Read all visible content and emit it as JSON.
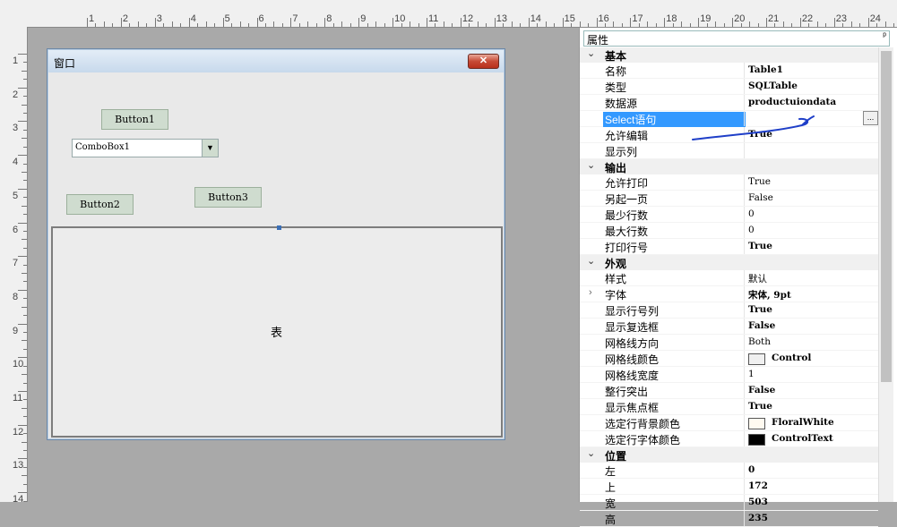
{
  "ruler": {
    "h_labels": [
      "1",
      "2",
      "3",
      "4",
      "5",
      "6",
      "7",
      "8",
      "9",
      "10",
      "11",
      "12",
      "13",
      "14",
      "15",
      "16",
      "17",
      "18",
      "19",
      "20",
      "21",
      "22",
      "23",
      "24"
    ],
    "v_labels": [
      "1",
      "2",
      "3",
      "4",
      "5",
      "6",
      "7",
      "8",
      "9",
      "10",
      "11",
      "12",
      "13",
      "14"
    ]
  },
  "form": {
    "title": "窗口",
    "close_glyph": "✕",
    "button1": "Button1",
    "button2": "Button2",
    "button3": "Button3",
    "combobox": "ComboBox1",
    "combo_arrow": "▼",
    "table_label": "表"
  },
  "property_grid": {
    "title": "属性",
    "pin": "ᵖ",
    "categories": {
      "basic": "基本",
      "output": "输出",
      "appearance": "外观",
      "position": "位置"
    },
    "props": {
      "name": {
        "label": "名称",
        "value": "Table1"
      },
      "type": {
        "label": "类型",
        "value": "SQLTable"
      },
      "datasource": {
        "label": "数据源",
        "value": "productuiondata"
      },
      "select": {
        "label": "Select语句",
        "value": ""
      },
      "allow_edit": {
        "label": "允许编辑",
        "value": "True"
      },
      "show_columns": {
        "label": "显示列",
        "value": ""
      },
      "allow_print": {
        "label": "允许打印",
        "value": "True"
      },
      "new_page": {
        "label": "另起一页",
        "value": "False"
      },
      "min_rows": {
        "label": "最少行数",
        "value": "0"
      },
      "max_rows": {
        "label": "最大行数",
        "value": "0"
      },
      "print_rownum": {
        "label": "打印行号",
        "value": "True"
      },
      "style": {
        "label": "样式",
        "value": "默认"
      },
      "font": {
        "label": "字体",
        "value": "宋体, 9pt"
      },
      "show_rownum_col": {
        "label": "显示行号列",
        "value": "True"
      },
      "show_checkbox": {
        "label": "显示复选框",
        "value": "False"
      },
      "grid_dir": {
        "label": "网格线方向",
        "value": "Both"
      },
      "grid_color": {
        "label": "网格线颜色",
        "value": "Control"
      },
      "grid_width": {
        "label": "网格线宽度",
        "value": "1"
      },
      "row_highlight": {
        "label": "整行突出",
        "value": "False"
      },
      "show_focus": {
        "label": "显示焦点框",
        "value": "True"
      },
      "sel_bg": {
        "label": "选定行背景颜色",
        "value": "FloralWhite"
      },
      "sel_font": {
        "label": "选定行字体颜色",
        "value": "ControlText"
      },
      "left": {
        "label": "左",
        "value": "0"
      },
      "top": {
        "label": "上",
        "value": "172"
      },
      "width": {
        "label": "宽",
        "value": "503"
      },
      "height": {
        "label": "高",
        "value": "235"
      }
    },
    "ellipsis": "...",
    "colors": {
      "grid_color_swatch": "#f0f0f0",
      "sel_bg_swatch": "#fffaf0",
      "sel_font_swatch": "#000000",
      "selection": "#3399ff"
    }
  }
}
